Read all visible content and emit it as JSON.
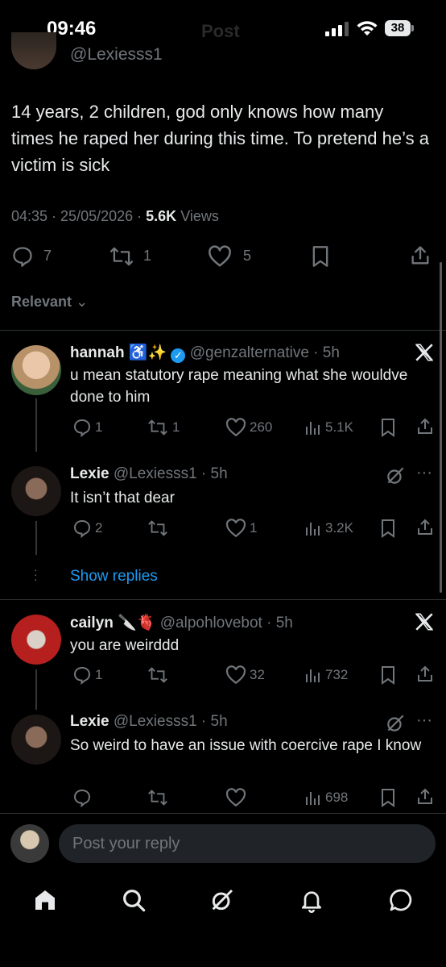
{
  "status_bar": {
    "time": "09:46",
    "ghost_title": "Post",
    "battery": "38"
  },
  "top_handle": "@Lexiesss1",
  "tweet": {
    "text": "14 years, 2 children, god only knows how many times he raped her during this time. To pretend he’s a victim is sick",
    "time": "04:35",
    "date": "25/05/2026",
    "views_count": "5.6K",
    "views_label": "Views",
    "replies": "7",
    "reposts": "1",
    "likes": "5"
  },
  "sort_label": "Relevant",
  "replies": [
    {
      "name": "hannah",
      "emoji": "♿✨",
      "handle": "@genzalternative",
      "age": "5h",
      "text": "u mean statutory rape meaning what she wouldve done to him",
      "replies": "1",
      "reposts": "1",
      "likes": "260",
      "views": "5.1K"
    },
    {
      "name": "Lexie",
      "handle": "@Lexiesss1",
      "age": "5h",
      "text": "It isn’t that dear",
      "replies": "2",
      "reposts": "",
      "likes": "1",
      "views": "3.2K"
    },
    {
      "name": "cailyn",
      "emoji": "🔪🫀",
      "handle": "@alpohlovebot",
      "age": "5h",
      "text": "you are weirddd",
      "replies": "1",
      "reposts": "",
      "likes": "32",
      "views": "732"
    },
    {
      "name": "Lexie",
      "handle": "@Lexiesss1",
      "age": "5h",
      "text": "So weird to have an issue with coercive rape I know",
      "replies": "",
      "reposts": "",
      "likes": "",
      "views": "698"
    }
  ],
  "show_replies": "Show replies",
  "reply_placeholder": "Post your reply",
  "colors": {
    "accent": "#1d9bf0",
    "bg": "#000000",
    "muted": "#71767b",
    "text": "#e7e9ea"
  }
}
